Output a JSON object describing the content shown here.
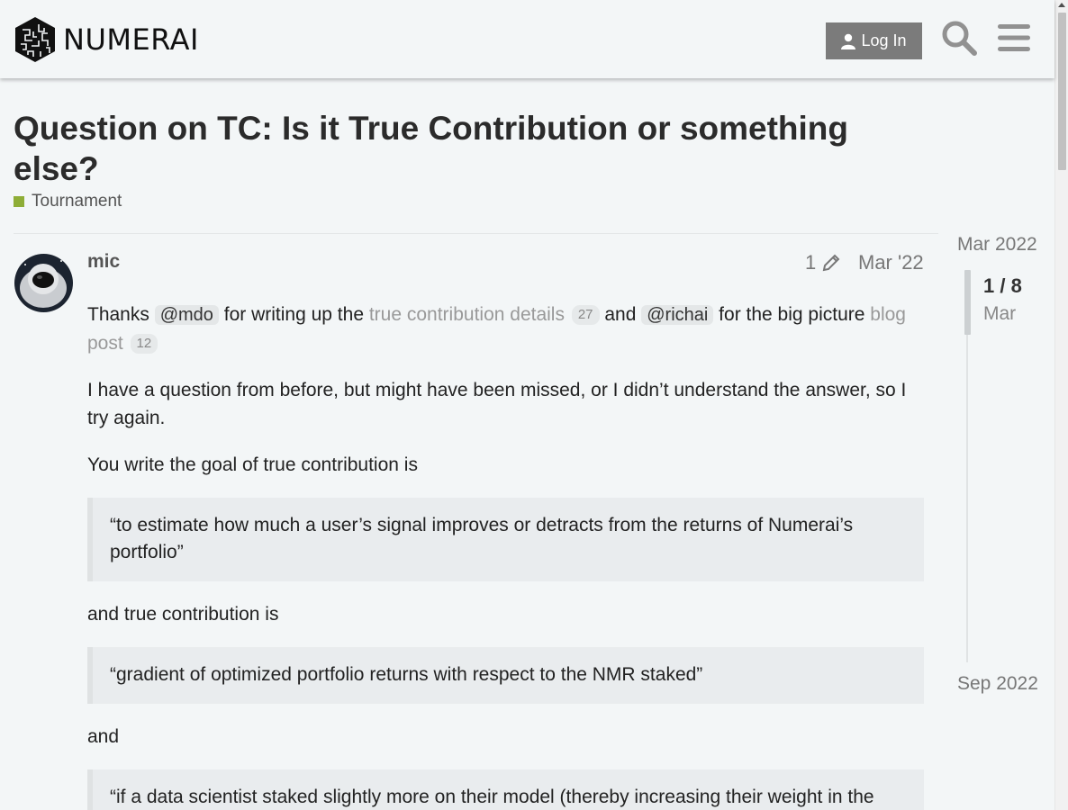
{
  "header": {
    "logo_text": "NUMERAI",
    "login_label": "Log In",
    "search_icon": "search-icon",
    "menu_icon": "hamburger-menu-icon"
  },
  "topic": {
    "title": "Question on TC: Is it True Contribution or something else?",
    "category": "Tournament",
    "category_color": "#8ead37"
  },
  "post": {
    "username": "mic",
    "edit_count": "1",
    "date": "Mar '22",
    "p1": {
      "t1": "Thanks ",
      "mention1": "@mdo",
      "t2": " for writing up the ",
      "link1": "true contribution details",
      "link1_clicks": "27",
      "t3": " and ",
      "mention2": "@richai",
      "t4": " for the big picture ",
      "link2": "blog post",
      "link2_clicks": "12"
    },
    "p2": "I have a question from before, but might have been missed, or I didn’t understand the answer, so I try again.",
    "p3": "You write the goal of true contribution is",
    "quote1": "“to estimate how much a user’s signal improves or detracts from the returns of Numerai’s portfolio”",
    "p4": "and true contribution is",
    "quote2": "“gradient of optimized portfolio returns with respect to the NMR staked”",
    "p5": "and",
    "quote3": "“if a data scientist staked slightly more on their model (thereby increasing their weight in the"
  },
  "timeline": {
    "start": "Mar 2022",
    "position": "1 / 8",
    "position_date": "Mar",
    "end": "Sep 2022"
  }
}
